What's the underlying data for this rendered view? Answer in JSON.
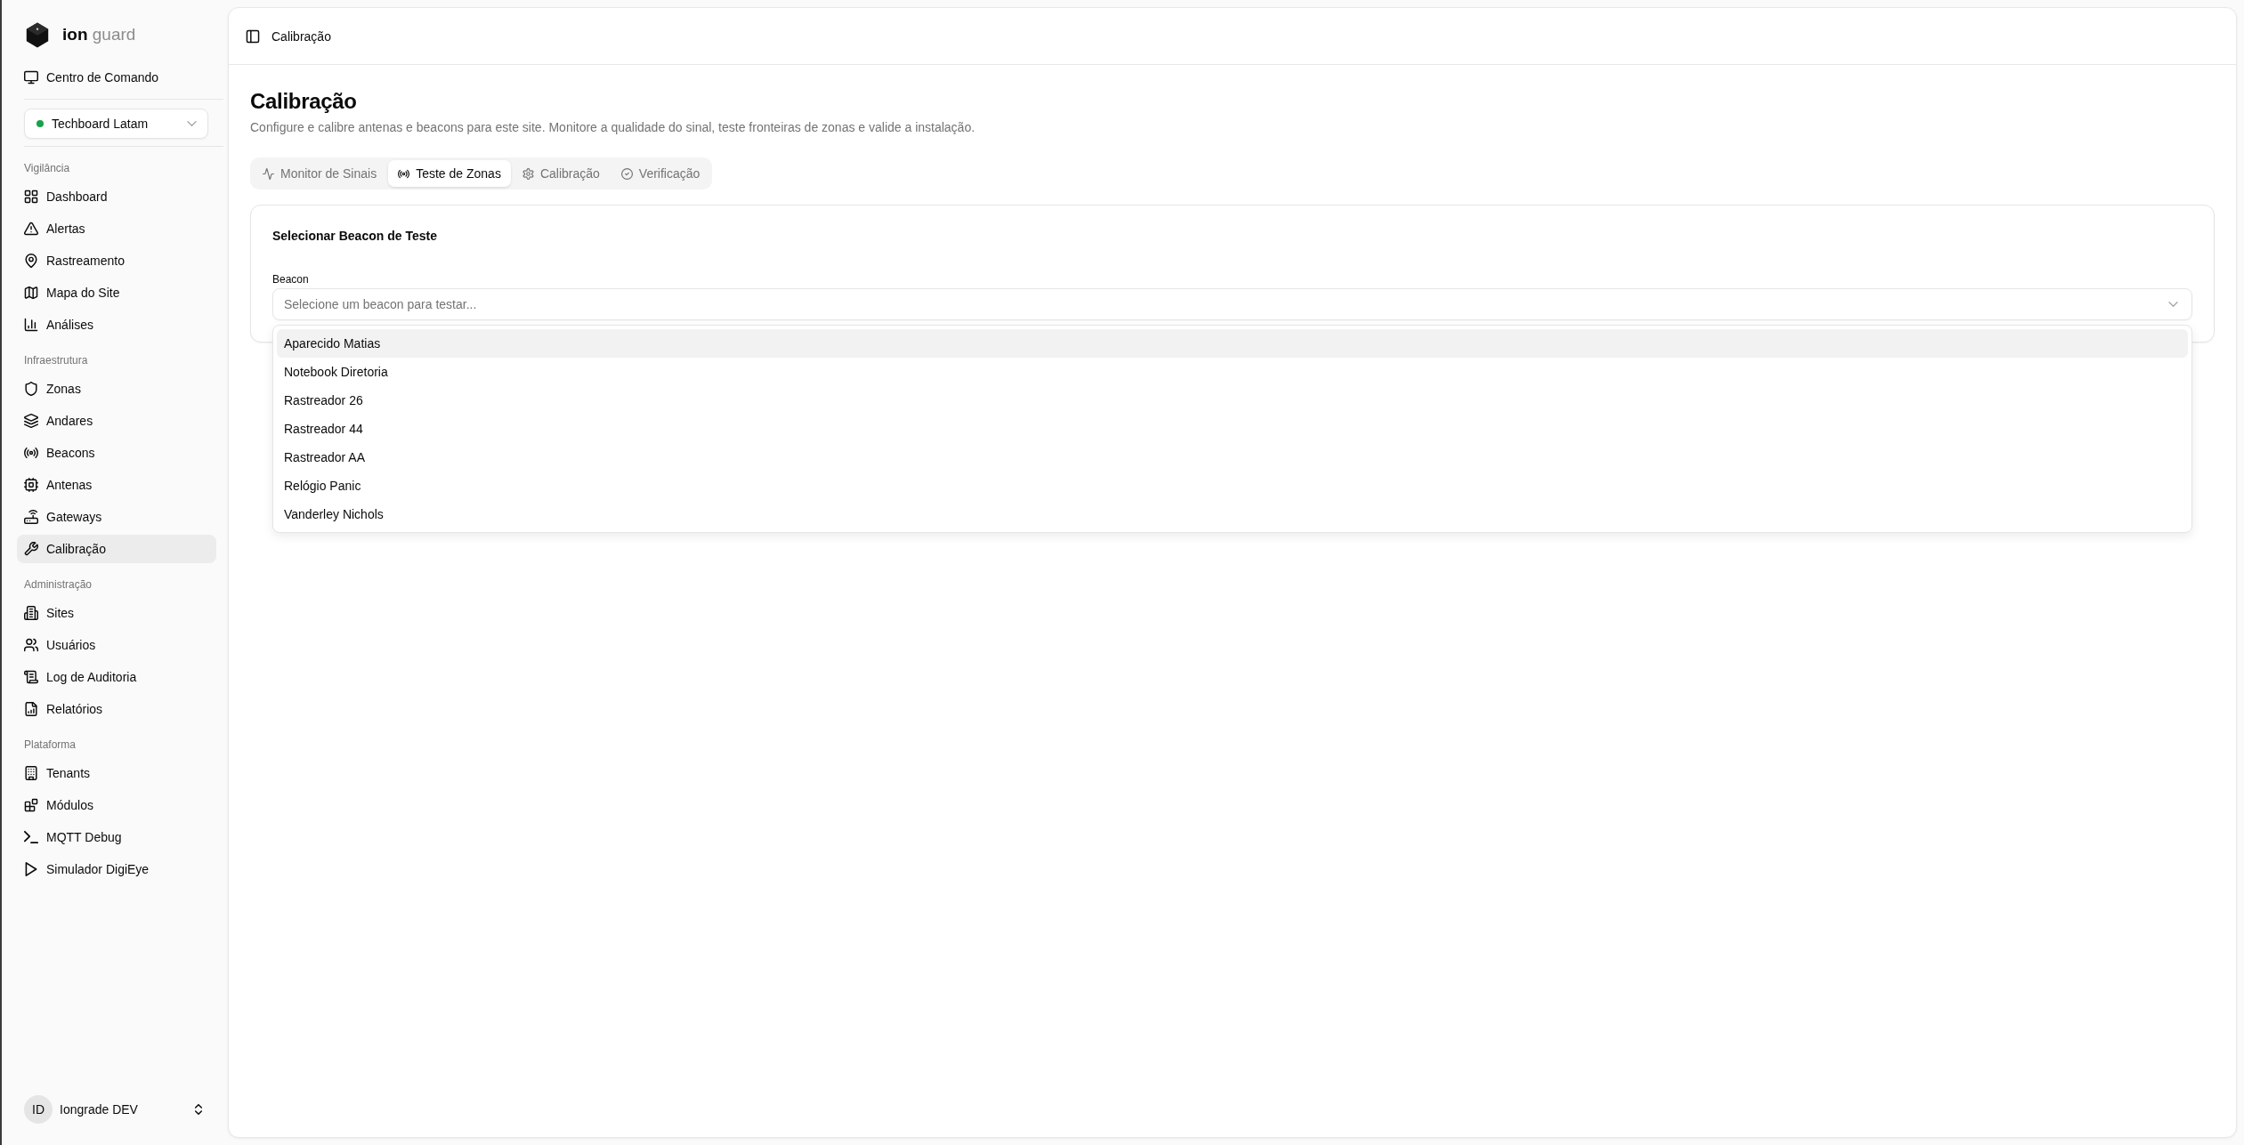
{
  "sidebar": {
    "brand": "**ion** guard",
    "command_center": {
      "label": "Centro de Comando"
    },
    "site_selector": {
      "value": "Techboard Latam",
      "online": true
    },
    "sections": [
      {
        "title": "Vigilância",
        "items": [
          {
            "label": "Dashboard",
            "selected": false
          },
          {
            "label": "Alertas",
            "selected": false
          },
          {
            "label": "Rastreamento",
            "selected": false
          },
          {
            "label": "Mapa do Site",
            "selected": false
          },
          {
            "label": "Análises",
            "selected": false
          }
        ]
      },
      {
        "title": "Infraestrutura",
        "items": [
          {
            "label": "Zonas",
            "selected": false
          },
          {
            "label": "Andares",
            "selected": false
          },
          {
            "label": "Beacons",
            "selected": false
          },
          {
            "label": "Antenas",
            "selected": false
          },
          {
            "label": "Gateways",
            "selected": false
          },
          {
            "label": "Calibração",
            "selected": true
          }
        ]
      },
      {
        "title": "Administração",
        "items": [
          {
            "label": "Sites",
            "selected": false
          },
          {
            "label": "Usuários",
            "selected": false
          },
          {
            "label": "Log de Auditoria",
            "selected": false
          },
          {
            "label": "Relatórios",
            "selected": false
          }
        ]
      },
      {
        "title": "Plataforma",
        "items": [
          {
            "label": "Tenants",
            "selected": false
          },
          {
            "label": "Módulos",
            "selected": false
          },
          {
            "label": "MQTT Debug",
            "selected": false
          },
          {
            "label": "Simulador DigiEye",
            "selected": false
          }
        ]
      }
    ],
    "user": {
      "initials": "ID",
      "name": "Iongrade DEV"
    }
  },
  "header": {
    "breadcrumb": "Calibração"
  },
  "page": {
    "title": "Calibração",
    "subtitle": "Configure e calibre antenas e beacons para este site. Monitore a qualidade do sinal, teste fronteiras de zonas e valide a instalação."
  },
  "tabs": [
    {
      "label": "Monitor de Sinais",
      "selected": false
    },
    {
      "label": "Teste de Zonas",
      "selected": true
    },
    {
      "label": "Calibração",
      "selected": false
    },
    {
      "label": "Verificação",
      "selected": false
    }
  ],
  "beacon_card": {
    "title": "Selecionar Beacon de Teste",
    "field_label": "Beacon",
    "placeholder": "Selecione um beacon para testar...",
    "expanded": true,
    "options": [
      {
        "label": "Aparecido Matias",
        "highlighted": true
      },
      {
        "label": "Notebook Diretoria",
        "highlighted": false
      },
      {
        "label": "Rastreador 26",
        "highlighted": false
      },
      {
        "label": "Rastreador 44",
        "highlighted": false
      },
      {
        "label": "Rastreador AA",
        "highlighted": false
      },
      {
        "label": "Relógio Panic",
        "highlighted": false
      },
      {
        "label": "Vanderley Nichols",
        "highlighted": false
      }
    ]
  }
}
